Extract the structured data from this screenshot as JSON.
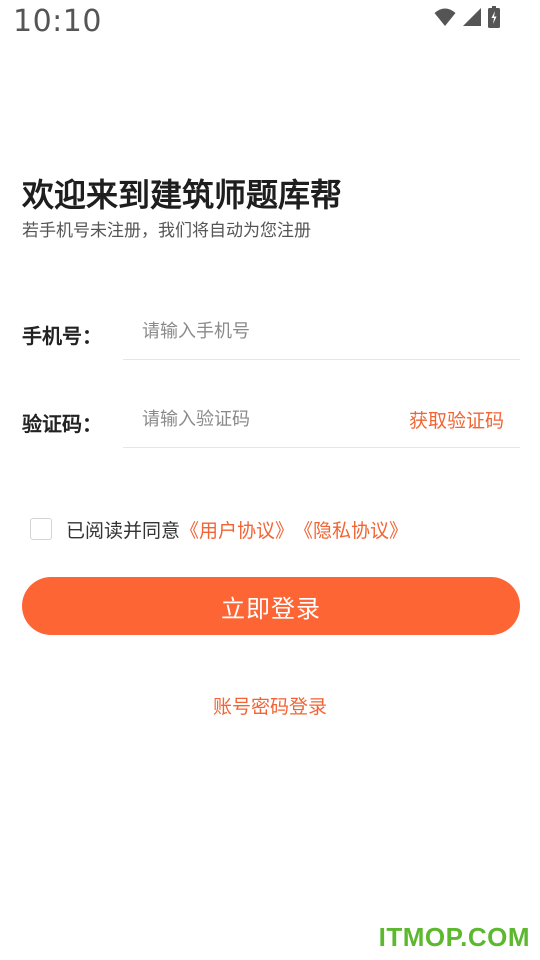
{
  "status_bar": {
    "time": "10:10",
    "icons": [
      "wifi-icon",
      "signal-icon",
      "battery-icon"
    ]
  },
  "header": {
    "title": "欢迎来到建筑师题库帮",
    "subtitle": "若手机号未注册，我们将自动为您注册"
  },
  "form": {
    "phone": {
      "label": "手机号：",
      "placeholder": "请输入手机号",
      "value": ""
    },
    "code": {
      "label": "验证码：",
      "placeholder": "请输入验证码",
      "value": "",
      "get_code_label": "获取验证码"
    }
  },
  "agreement": {
    "checked": false,
    "prefix": "已阅读并同意",
    "user_agreement": "《用户协议》",
    "privacy_policy": "《隐私协议》"
  },
  "login_button": {
    "label": "立即登录"
  },
  "alt_login": {
    "label": "账号密码登录"
  },
  "watermark": {
    "text": "ITMOP.COM"
  },
  "colors": {
    "accent": "#fd6534",
    "link": "#f26434",
    "watermark": "#5cb82e"
  }
}
